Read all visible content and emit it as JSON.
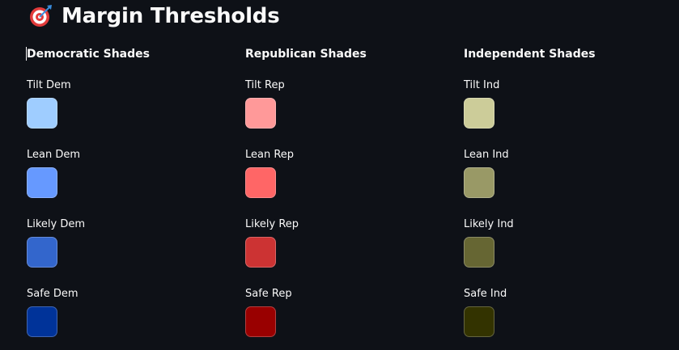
{
  "header": {
    "title": "Margin Thresholds",
    "icon": "target-icon"
  },
  "columns": [
    {
      "key": "dem",
      "header": "Democratic Shades",
      "shades": [
        {
          "label": "Tilt Dem",
          "color": "#9fcdff"
        },
        {
          "label": "Lean Dem",
          "color": "#6699ff"
        },
        {
          "label": "Likely Dem",
          "color": "#3366cc"
        },
        {
          "label": "Safe Dem",
          "color": "#003399"
        }
      ]
    },
    {
      "key": "rep",
      "header": "Republican Shades",
      "shades": [
        {
          "label": "Tilt Rep",
          "color": "#ff9999"
        },
        {
          "label": "Lean Rep",
          "color": "#ff6666"
        },
        {
          "label": "Likely Rep",
          "color": "#cc3333"
        },
        {
          "label": "Safe Rep",
          "color": "#990000"
        }
      ]
    },
    {
      "key": "ind",
      "header": "Independent Shades",
      "shades": [
        {
          "label": "Tilt Ind",
          "color": "#cccc99"
        },
        {
          "label": "Lean Ind",
          "color": "#999966"
        },
        {
          "label": "Likely Ind",
          "color": "#666633"
        },
        {
          "label": "Safe Ind",
          "color": "#333300"
        }
      ]
    }
  ]
}
